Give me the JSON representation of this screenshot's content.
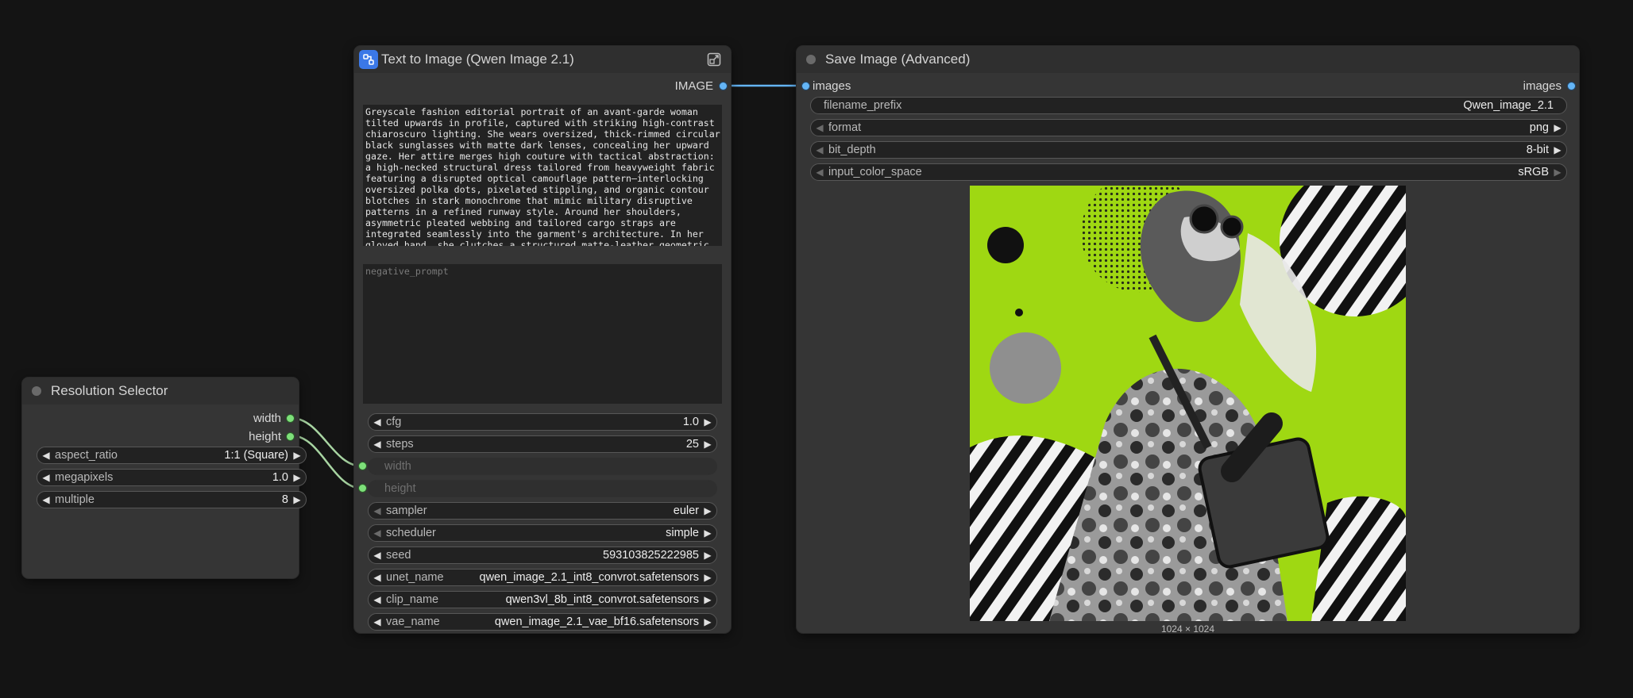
{
  "colors": {
    "canvas_bg": "#141414",
    "node_bg": "#353535",
    "link_image": "#64b5f6",
    "link_int": "#a8d5a2",
    "slot_int": "#7ee07a",
    "slot_image": "#64b5f6",
    "subgraph_icon": "#3b78e7",
    "preview_accent": "#9fd812"
  },
  "resolution_node": {
    "title": "Resolution Selector",
    "outputs": [
      "width",
      "height"
    ],
    "widgets": [
      {
        "label": "aspect_ratio",
        "value": "1:1 (Square)"
      },
      {
        "label": "megapixels",
        "value": "1.0"
      },
      {
        "label": "multiple",
        "value": "8"
      }
    ]
  },
  "t2i_node": {
    "title": "Text to Image (Qwen Image 2.1)",
    "header_icon": "subgraph-icon",
    "expand_icon": "open-subgraph-icon",
    "output": "IMAGE",
    "prompt": "Greyscale fashion editorial portrait of an avant-garde woman tilted upwards in profile, captured with striking high-contrast chiaroscuro lighting. She wears oversized, thick-rimmed circular black sunglasses with matte dark lenses, concealing her upward gaze. Her attire merges high couture with tactical abstraction: a high-necked structural dress tailored from heavyweight fabric featuring a disrupted optical camouflage pattern—interlocking oversized polka dots, pixelated stippling, and organic contour blotches in stark monochrome that mimic military disruptive patterns in a refined runway style. Around her shoulders, asymmetric pleated webbing and tailored cargo straps are integrated seamlessly into the garment's architecture. In her gloved hand, she clutches a structured matte-leather geometric",
    "negative_placeholder": "negative_prompt",
    "widgets_top": [
      {
        "label": "cfg",
        "value": "1.0"
      },
      {
        "label": "steps",
        "value": "25"
      }
    ],
    "inputs_linked": [
      "width",
      "height"
    ],
    "widgets_bottom": [
      {
        "label": "sampler",
        "value": "euler"
      },
      {
        "label": "scheduler",
        "value": "simple"
      },
      {
        "label": "seed",
        "value": "593103825222985"
      },
      {
        "label": "unet_name",
        "value": "qwen_image_2.1_int8_convrot.safetensors"
      },
      {
        "label": "clip_name",
        "value": "qwen3vl_8b_int8_convrot.safetensors"
      },
      {
        "label": "vae_name",
        "value": "qwen_image_2.1_vae_bf16.safetensors"
      }
    ]
  },
  "save_node": {
    "title": "Save Image (Advanced)",
    "input": "images",
    "output": "images",
    "widgets": [
      {
        "label": "filename_prefix",
        "value": "Qwen_image_2.1"
      },
      {
        "label": "format",
        "value": "png"
      },
      {
        "label": "bit_depth",
        "value": "8-bit"
      },
      {
        "label": "input_color_space",
        "value": "sRGB"
      }
    ],
    "preview_size": "1024 × 1024"
  }
}
